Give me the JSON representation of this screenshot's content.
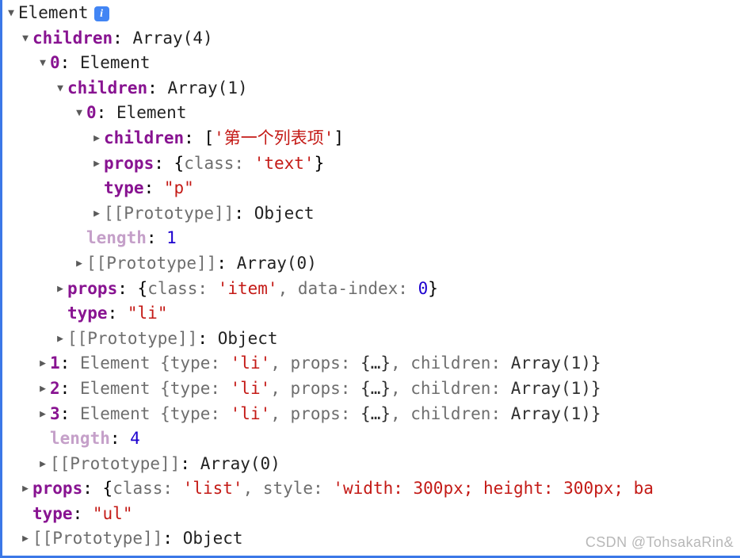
{
  "panel": {
    "accent_color": "#3b78e7",
    "background": "#ffffff",
    "watermark": "CSDN @TohsakaRin&"
  },
  "tokens": {
    "colon": ":",
    "comma": ",",
    "open_brace": "{",
    "close_brace": "}",
    "open_bracket": "[",
    "close_bracket": "]",
    "ellipsis_obj": "{…}",
    "info_glyph": "i"
  },
  "tree": {
    "root": {
      "label": "Element",
      "expanded": true
    },
    "rows": [
      {
        "id": "root",
        "indent": 0,
        "marker": "open",
        "key": "Element",
        "key_style": "plain",
        "value": "",
        "has_info_icon": true
      },
      {
        "id": "children-l1",
        "indent": 1,
        "marker": "open",
        "key": "children",
        "key_style": "own",
        "value": "Array(4)",
        "value_style": "plain"
      },
      {
        "id": "children-l1-0",
        "indent": 2,
        "marker": "open",
        "key": "0",
        "key_style": "idx",
        "value": "Element",
        "value_style": "plain"
      },
      {
        "id": "children-l2",
        "indent": 3,
        "marker": "open",
        "key": "children",
        "key_style": "own",
        "value": "Array(1)",
        "value_style": "plain"
      },
      {
        "id": "children-l2-0",
        "indent": 4,
        "marker": "open",
        "key": "0",
        "key_style": "idx",
        "value": "Element",
        "value_style": "plain"
      },
      {
        "id": "p-children",
        "indent": 5,
        "marker": "closed",
        "key": "children",
        "key_style": "own",
        "value_parts": [
          {
            "text": "[",
            "style": "punct"
          },
          {
            "text": "'第一个列表项'",
            "style": "str"
          },
          {
            "text": "]",
            "style": "punct"
          }
        ]
      },
      {
        "id": "p-props",
        "indent": 5,
        "marker": "closed",
        "key": "props",
        "key_style": "own",
        "value_parts": [
          {
            "text": "{",
            "style": "punct"
          },
          {
            "text": "class",
            "style": "preview"
          },
          {
            "text": ": ",
            "style": "preview"
          },
          {
            "text": "'text'",
            "style": "str"
          },
          {
            "text": "}",
            "style": "punct"
          }
        ]
      },
      {
        "id": "p-type",
        "indent": 5,
        "marker": "none",
        "key": "type",
        "key_style": "own",
        "value": "\"p\"",
        "value_style": "str"
      },
      {
        "id": "p-prototype",
        "indent": 5,
        "marker": "closed",
        "key": "[[Prototype]]",
        "key_style": "proto",
        "value": "Object",
        "value_style": "plain"
      },
      {
        "id": "l2-length",
        "indent": 4,
        "marker": "none",
        "key": "length",
        "key_style": "dim",
        "value": "1",
        "value_style": "num"
      },
      {
        "id": "l2-prototype",
        "indent": 4,
        "marker": "closed",
        "key": "[[Prototype]]",
        "key_style": "proto",
        "value": "Array(0)",
        "value_style": "plain"
      },
      {
        "id": "li-props",
        "indent": 3,
        "marker": "closed",
        "key": "props",
        "key_style": "own",
        "value_parts": [
          {
            "text": "{",
            "style": "punct"
          },
          {
            "text": "class",
            "style": "preview"
          },
          {
            "text": ": ",
            "style": "preview"
          },
          {
            "text": "'item'",
            "style": "str"
          },
          {
            "text": ", ",
            "style": "preview"
          },
          {
            "text": "data-index",
            "style": "preview"
          },
          {
            "text": ": ",
            "style": "preview"
          },
          {
            "text": "0",
            "style": "num"
          },
          {
            "text": "}",
            "style": "punct"
          }
        ]
      },
      {
        "id": "li-type",
        "indent": 3,
        "marker": "none",
        "key": "type",
        "key_style": "own",
        "value": "\"li\"",
        "value_style": "str"
      },
      {
        "id": "li-prototype",
        "indent": 3,
        "marker": "closed",
        "key": "[[Prototype]]",
        "key_style": "proto",
        "value": "Object",
        "value_style": "plain"
      },
      {
        "id": "children-l1-1",
        "indent": 2,
        "marker": "closed",
        "key": "1",
        "key_style": "idx",
        "value_parts": [
          {
            "text": "Element ",
            "style": "preview"
          },
          {
            "text": "{",
            "style": "preview"
          },
          {
            "text": "type",
            "style": "preview"
          },
          {
            "text": ": ",
            "style": "preview"
          },
          {
            "text": "'li'",
            "style": "str"
          },
          {
            "text": ", ",
            "style": "preview"
          },
          {
            "text": "props",
            "style": "preview"
          },
          {
            "text": ": ",
            "style": "preview"
          },
          {
            "text": "{…}",
            "style": "preview-strong"
          },
          {
            "text": ", ",
            "style": "preview"
          },
          {
            "text": "children",
            "style": "preview"
          },
          {
            "text": ": ",
            "style": "preview"
          },
          {
            "text": "Array(1)}",
            "style": "preview-strong"
          }
        ]
      },
      {
        "id": "children-l1-2",
        "indent": 2,
        "marker": "closed",
        "key": "2",
        "key_style": "idx",
        "value_parts": [
          {
            "text": "Element ",
            "style": "preview"
          },
          {
            "text": "{",
            "style": "preview"
          },
          {
            "text": "type",
            "style": "preview"
          },
          {
            "text": ": ",
            "style": "preview"
          },
          {
            "text": "'li'",
            "style": "str"
          },
          {
            "text": ", ",
            "style": "preview"
          },
          {
            "text": "props",
            "style": "preview"
          },
          {
            "text": ": ",
            "style": "preview"
          },
          {
            "text": "{…}",
            "style": "preview-strong"
          },
          {
            "text": ", ",
            "style": "preview"
          },
          {
            "text": "children",
            "style": "preview"
          },
          {
            "text": ": ",
            "style": "preview"
          },
          {
            "text": "Array(1)}",
            "style": "preview-strong"
          }
        ]
      },
      {
        "id": "children-l1-3",
        "indent": 2,
        "marker": "closed",
        "key": "3",
        "key_style": "idx",
        "value_parts": [
          {
            "text": "Element ",
            "style": "preview"
          },
          {
            "text": "{",
            "style": "preview"
          },
          {
            "text": "type",
            "style": "preview"
          },
          {
            "text": ": ",
            "style": "preview"
          },
          {
            "text": "'li'",
            "style": "str"
          },
          {
            "text": ", ",
            "style": "preview"
          },
          {
            "text": "props",
            "style": "preview"
          },
          {
            "text": ": ",
            "style": "preview"
          },
          {
            "text": "{…}",
            "style": "preview-strong"
          },
          {
            "text": ", ",
            "style": "preview"
          },
          {
            "text": "children",
            "style": "preview"
          },
          {
            "text": ": ",
            "style": "preview"
          },
          {
            "text": "Array(1)}",
            "style": "preview-strong"
          }
        ]
      },
      {
        "id": "l1-length",
        "indent": 2,
        "marker": "none",
        "key": "length",
        "key_style": "dim",
        "value": "4",
        "value_style": "num"
      },
      {
        "id": "l1-prototype",
        "indent": 2,
        "marker": "closed",
        "key": "[[Prototype]]",
        "key_style": "proto",
        "value": "Array(0)",
        "value_style": "plain"
      },
      {
        "id": "ul-props",
        "indent": 1,
        "marker": "closed",
        "key": "props",
        "key_style": "own",
        "value_parts": [
          {
            "text": "{",
            "style": "punct"
          },
          {
            "text": "class",
            "style": "preview"
          },
          {
            "text": ": ",
            "style": "preview"
          },
          {
            "text": "'list'",
            "style": "str"
          },
          {
            "text": ", ",
            "style": "preview"
          },
          {
            "text": "style",
            "style": "preview"
          },
          {
            "text": ": ",
            "style": "preview"
          },
          {
            "text": "'width: 300px; height: 300px; ba",
            "style": "str"
          }
        ]
      },
      {
        "id": "ul-type",
        "indent": 1,
        "marker": "none",
        "key": "type",
        "key_style": "own",
        "value": "\"ul\"",
        "value_style": "str"
      },
      {
        "id": "ul-prototype",
        "indent": 1,
        "marker": "closed",
        "key": "[[Prototype]]",
        "key_style": "proto",
        "value": "Object",
        "value_style": "plain"
      }
    ]
  }
}
